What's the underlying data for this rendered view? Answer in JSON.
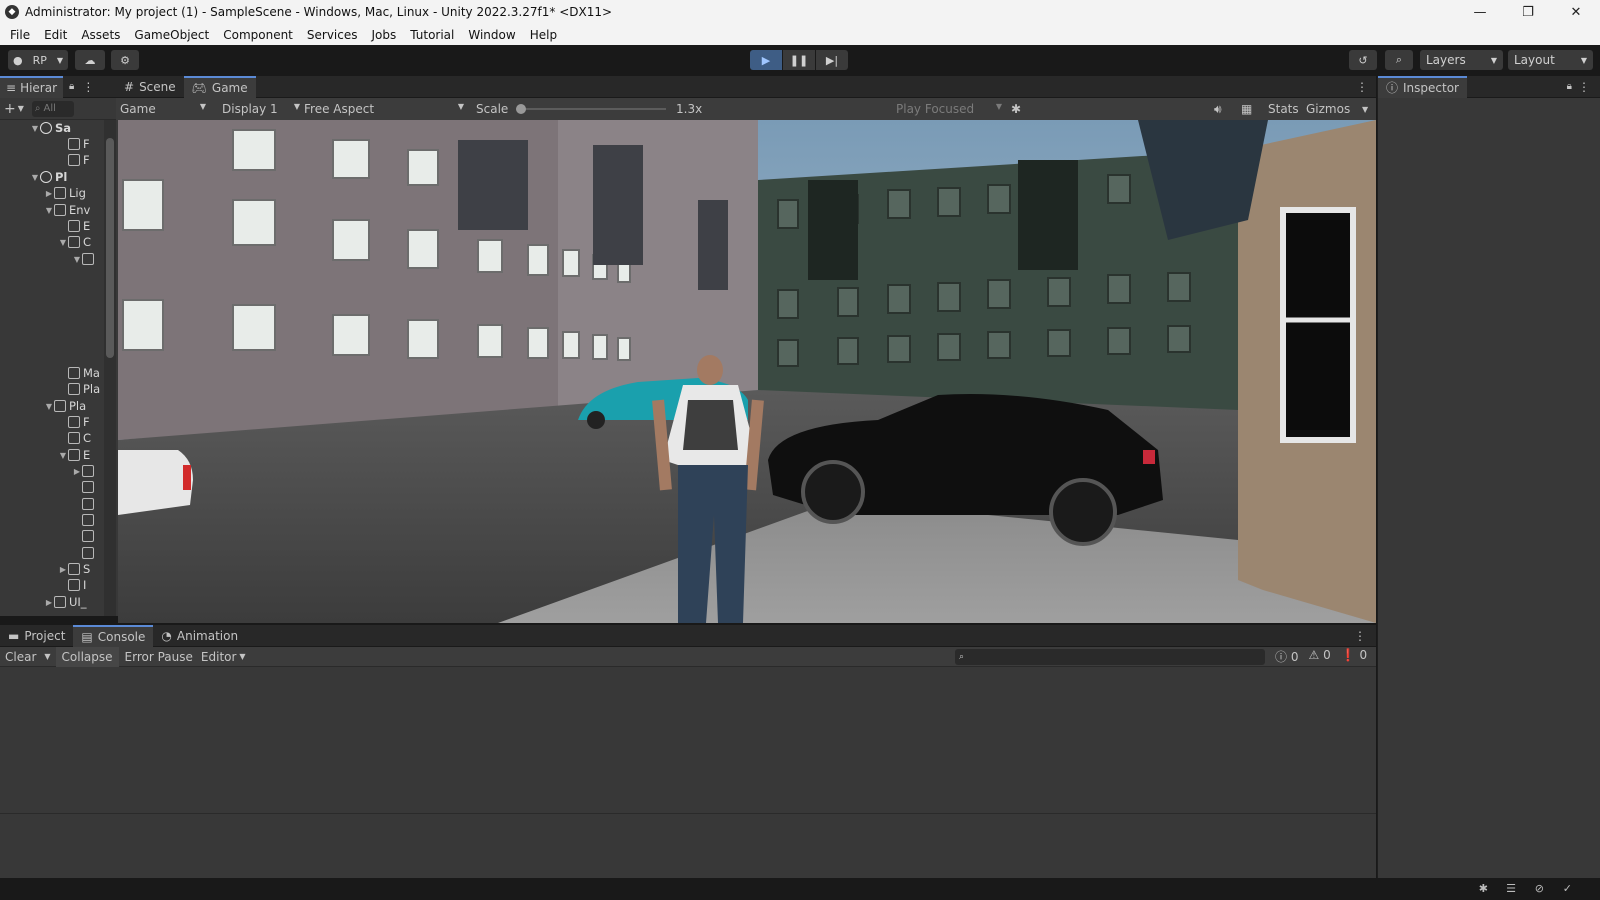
{
  "window": {
    "title": "Administrator: My project (1) - SampleScene - Windows, Mac, Linux - Unity 2022.3.27f1* <DX11>"
  },
  "menu": [
    "File",
    "Edit",
    "Assets",
    "GameObject",
    "Component",
    "Services",
    "Jobs",
    "Tutorial",
    "Window",
    "Help"
  ],
  "toolbar": {
    "account": "RP",
    "layers": "Layers",
    "layout": "Layout"
  },
  "hierarchy": {
    "tab": "Hierar",
    "search_placeholder": "All",
    "rows": [
      {
        "label": "Sa",
        "indent": 0,
        "expanded": true,
        "scene": true
      },
      {
        "label": "F",
        "indent": 2
      },
      {
        "label": "F",
        "indent": 2
      },
      {
        "label": "Pl",
        "indent": 0,
        "expanded": true,
        "scene": true
      },
      {
        "label": "Lig",
        "indent": 1,
        "collapsed": true
      },
      {
        "label": "Env",
        "indent": 1,
        "expanded": true
      },
      {
        "label": "E",
        "indent": 2
      },
      {
        "label": "C",
        "indent": 2,
        "expanded": true
      },
      {
        "label": "",
        "indent": 3,
        "expanded": true
      },
      {
        "label": "Ma",
        "indent": 2
      },
      {
        "label": "Pla",
        "indent": 2
      },
      {
        "label": "Pla",
        "indent": 1,
        "expanded": true
      },
      {
        "label": "F",
        "indent": 2
      },
      {
        "label": "C",
        "indent": 2
      },
      {
        "label": "E",
        "indent": 2,
        "expanded": true
      },
      {
        "label": "",
        "indent": 3,
        "collapsed": true
      },
      {
        "label": "",
        "indent": 3
      },
      {
        "label": "",
        "indent": 3
      },
      {
        "label": "",
        "indent": 3
      },
      {
        "label": "",
        "indent": 3
      },
      {
        "label": "",
        "indent": 3
      },
      {
        "label": "S",
        "indent": 2,
        "collapsed": true
      },
      {
        "label": "I",
        "indent": 2
      },
      {
        "label": "UI_",
        "indent": 1,
        "collapsed": true
      }
    ]
  },
  "game": {
    "tabs": [
      "Scene",
      "Game"
    ],
    "view_mode": "Game",
    "display": "Display 1",
    "aspect": "Free Aspect",
    "scale_label": "Scale",
    "scale_value": "1.3x",
    "play_focused": "Play Focused",
    "stats": "Stats",
    "gizmos": "Gizmos"
  },
  "inspector": {
    "tab": "Inspector"
  },
  "bottom": {
    "tabs": [
      "Project",
      "Console",
      "Animation"
    ],
    "clear": "Clear",
    "collapse": "Collapse",
    "error_pause": "Error Pause",
    "editor": "Editor",
    "counts": {
      "log": "0",
      "warn": "0",
      "error": "0"
    }
  }
}
